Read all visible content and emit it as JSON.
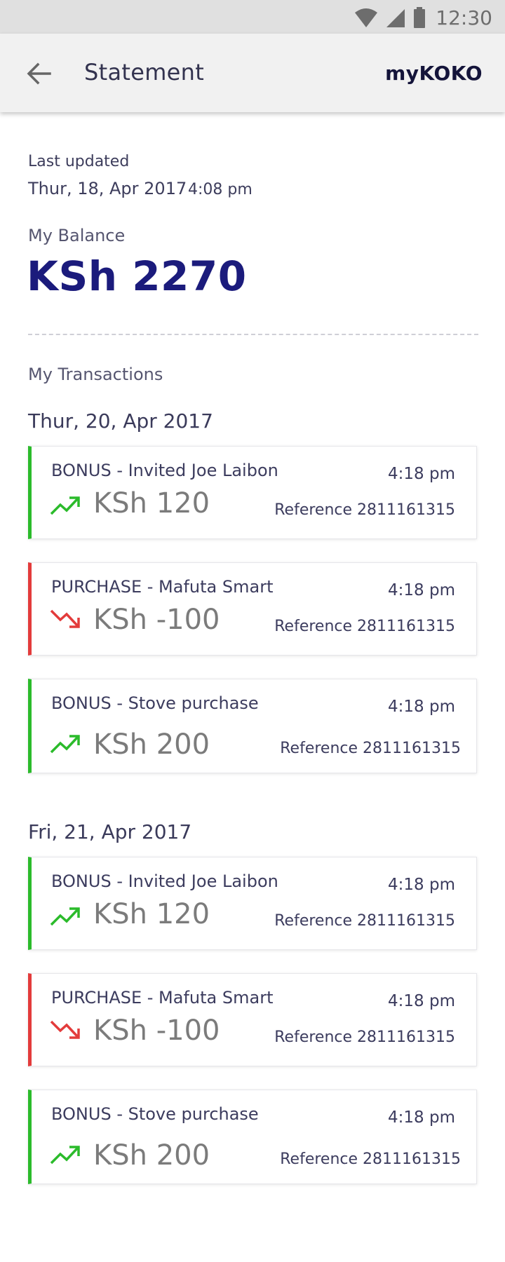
{
  "status_bar": {
    "time": "12:30",
    "icons": [
      "wifi-icon",
      "cell-signal-icon",
      "battery-icon"
    ]
  },
  "header": {
    "title": "Statement",
    "brand": "myKOKO",
    "back_icon": "arrow-left-icon"
  },
  "summary": {
    "last_updated_label": "Last updated",
    "last_updated_date": "Thur, 18, Apr 2017",
    "last_updated_time": "4:08 pm",
    "balance_label": "My Balance",
    "balance_value": "KSh 2270"
  },
  "transactions_label": "My Transactions",
  "groups": [
    {
      "date": "Thur, 20, Apr 2017",
      "items": [
        {
          "type": "bonus",
          "title": "BONUS - Invited Joe Laibon",
          "time": "4:18 pm",
          "amount": "KSh 120",
          "reference": "Reference 2811161315",
          "icon": "trending-up-icon"
        },
        {
          "type": "purchase",
          "title": "PURCHASE - Mafuta Smart",
          "time": "4:18 pm",
          "amount": "KSh -100",
          "reference": "Reference 2811161315",
          "icon": "trending-down-icon"
        },
        {
          "type": "bonus",
          "title": "BONUS - Stove purchase",
          "time": "4:18 pm",
          "amount": "KSh 200",
          "reference": "Reference 2811161315",
          "icon": "trending-up-icon"
        }
      ]
    },
    {
      "date": "Fri, 21, Apr 2017",
      "items": [
        {
          "type": "bonus",
          "title": "BONUS - Invited Joe Laibon",
          "time": "4:18 pm",
          "amount": "KSh 120",
          "reference": "Reference 2811161315",
          "icon": "trending-up-icon"
        },
        {
          "type": "purchase",
          "title": "PURCHASE - Mafuta Smart",
          "time": "4:18 pm",
          "amount": "KSh -100",
          "reference": "Reference 2811161315",
          "icon": "trending-down-icon"
        },
        {
          "type": "bonus",
          "title": "BONUS - Stove purchase",
          "time": "4:18 pm",
          "amount": "KSh 200",
          "reference": "Reference 2811161315",
          "icon": "trending-up-icon"
        }
      ]
    }
  ],
  "colors": {
    "bonus": "#2bbb2b",
    "purchase": "#e33b3b",
    "balance": "#1b1b7c",
    "app_bar": "#f1f1f1",
    "status_bar": "#e0e0e0"
  }
}
